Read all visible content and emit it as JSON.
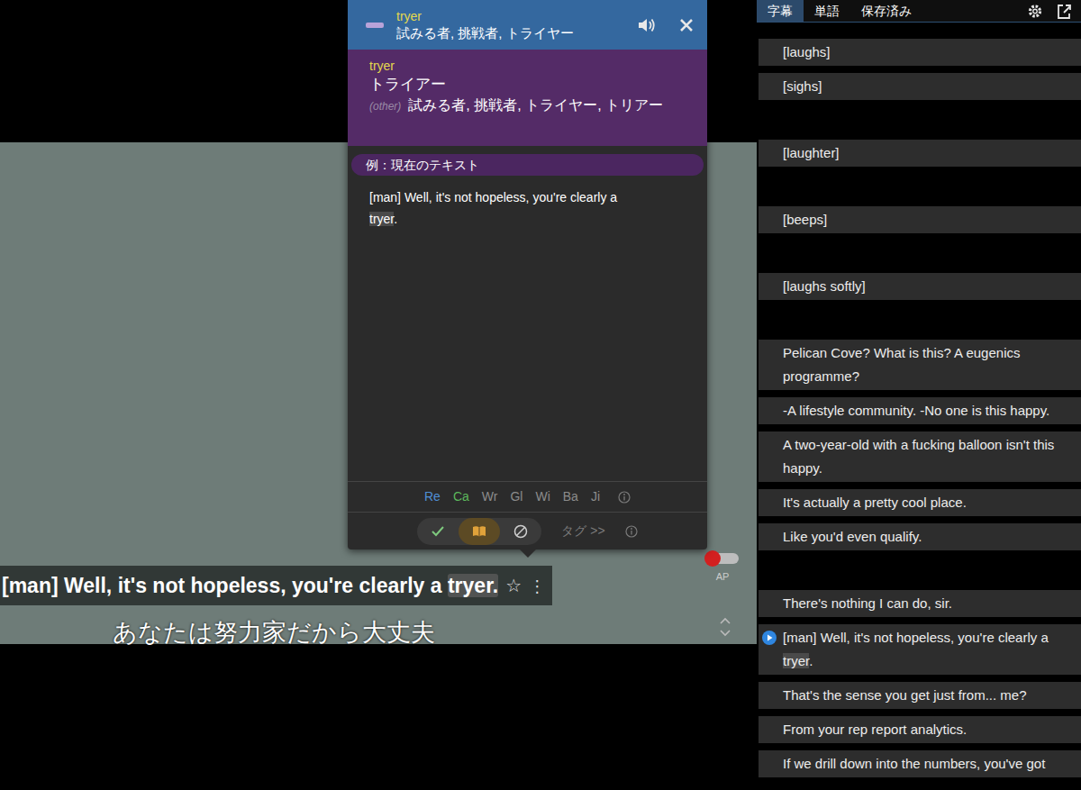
{
  "player": {
    "subtitle_en": [
      {
        "text": "[man] Well, it's not hopeless, you're clearly a ",
        "highlight": false
      },
      {
        "text": "tryer.",
        "highlight": true
      }
    ],
    "star": "☆",
    "menu": "⋮",
    "subtitle_ja": "あなたは努力家だから大丈夫",
    "ap": {
      "label": "AP",
      "on": false
    }
  },
  "popup": {
    "header": {
      "word": "tryer",
      "meaning": "試みる者, 挑戦者, トライヤー"
    },
    "entry": {
      "word": "tryer",
      "reading": "トライアー",
      "other_label": "(other)",
      "other": "試みる者, 挑戦者, トライヤー, トリアー"
    },
    "example_label": "例：現在のテキスト",
    "example": [
      {
        "text": "[man] Well, it's not hopeless, you're clearly a ",
        "highlight": false
      },
      {
        "text": "tryer",
        "highlight": true
      },
      {
        "text": ".",
        "highlight": false
      }
    ],
    "sources": [
      {
        "label": "Re",
        "color": "#4f8fd6"
      },
      {
        "label": "Ca",
        "color": "#5cb85c"
      },
      {
        "label": "Wr",
        "color": "#8c8c8c"
      },
      {
        "label": "Gl",
        "color": "#8c8c8c"
      },
      {
        "label": "Wi",
        "color": "#8c8c8c"
      },
      {
        "label": "Ba",
        "color": "#8c8c8c"
      },
      {
        "label": "Ji",
        "color": "#8c8c8c"
      }
    ],
    "actions": [
      {
        "kind": "known",
        "selected": false
      },
      {
        "kind": "learning",
        "selected": true
      },
      {
        "kind": "ignore",
        "selected": false
      }
    ],
    "tag": "タグ >>"
  },
  "side": {
    "tabs": [
      {
        "label": "字幕",
        "selected": true
      },
      {
        "label": "単語",
        "selected": false
      },
      {
        "label": "保存済み",
        "selected": false
      }
    ],
    "items": [
      {
        "kind": "line",
        "current": false,
        "segments": [
          {
            "text": "[laughs]",
            "highlight": false
          }
        ]
      },
      {
        "kind": "line",
        "current": false,
        "segments": [
          {
            "text": "[sighs]",
            "highlight": false
          }
        ]
      },
      {
        "kind": "blank"
      },
      {
        "kind": "line",
        "current": false,
        "segments": [
          {
            "text": "[laughter]",
            "highlight": false
          }
        ]
      },
      {
        "kind": "blank"
      },
      {
        "kind": "line",
        "current": false,
        "segments": [
          {
            "text": "[beeps]",
            "highlight": false
          }
        ]
      },
      {
        "kind": "blank"
      },
      {
        "kind": "line",
        "current": false,
        "segments": [
          {
            "text": "[laughs softly]",
            "highlight": false
          }
        ]
      },
      {
        "kind": "blank"
      },
      {
        "kind": "line",
        "current": false,
        "segments": [
          {
            "text": "Pelican Cove? What is this? A eugenics programme?",
            "highlight": false
          }
        ]
      },
      {
        "kind": "line",
        "current": false,
        "segments": [
          {
            "text": "-A lifestyle community. -No one is this happy.",
            "highlight": false
          }
        ]
      },
      {
        "kind": "line",
        "current": false,
        "segments": [
          {
            "text": "A two-year-old with a fucking balloon isn't this happy.",
            "highlight": false
          }
        ]
      },
      {
        "kind": "line",
        "current": false,
        "segments": [
          {
            "text": "It's actually a pretty cool place.",
            "highlight": false
          }
        ]
      },
      {
        "kind": "line",
        "current": false,
        "segments": [
          {
            "text": "Like you'd even qualify.",
            "highlight": false
          }
        ]
      },
      {
        "kind": "blank"
      },
      {
        "kind": "line",
        "current": false,
        "segments": [
          {
            "text": "There's nothing I can do, sir.",
            "highlight": false
          }
        ]
      },
      {
        "kind": "line",
        "current": true,
        "segments": [
          {
            "text": "[man] Well, it's not hopeless, you're clearly a ",
            "highlight": false
          },
          {
            "text": "tryer",
            "highlight": true
          },
          {
            "text": ".",
            "highlight": false
          }
        ]
      },
      {
        "kind": "line",
        "current": false,
        "segments": [
          {
            "text": "That's the sense you get just from... me?",
            "highlight": false
          }
        ]
      },
      {
        "kind": "line",
        "current": false,
        "segments": [
          {
            "text": "From your rep report analytics.",
            "highlight": false
          }
        ]
      },
      {
        "kind": "line",
        "current": false,
        "segments": [
          {
            "text": "If we drill down into the numbers, you've got",
            "highlight": false
          }
        ]
      }
    ]
  }
}
